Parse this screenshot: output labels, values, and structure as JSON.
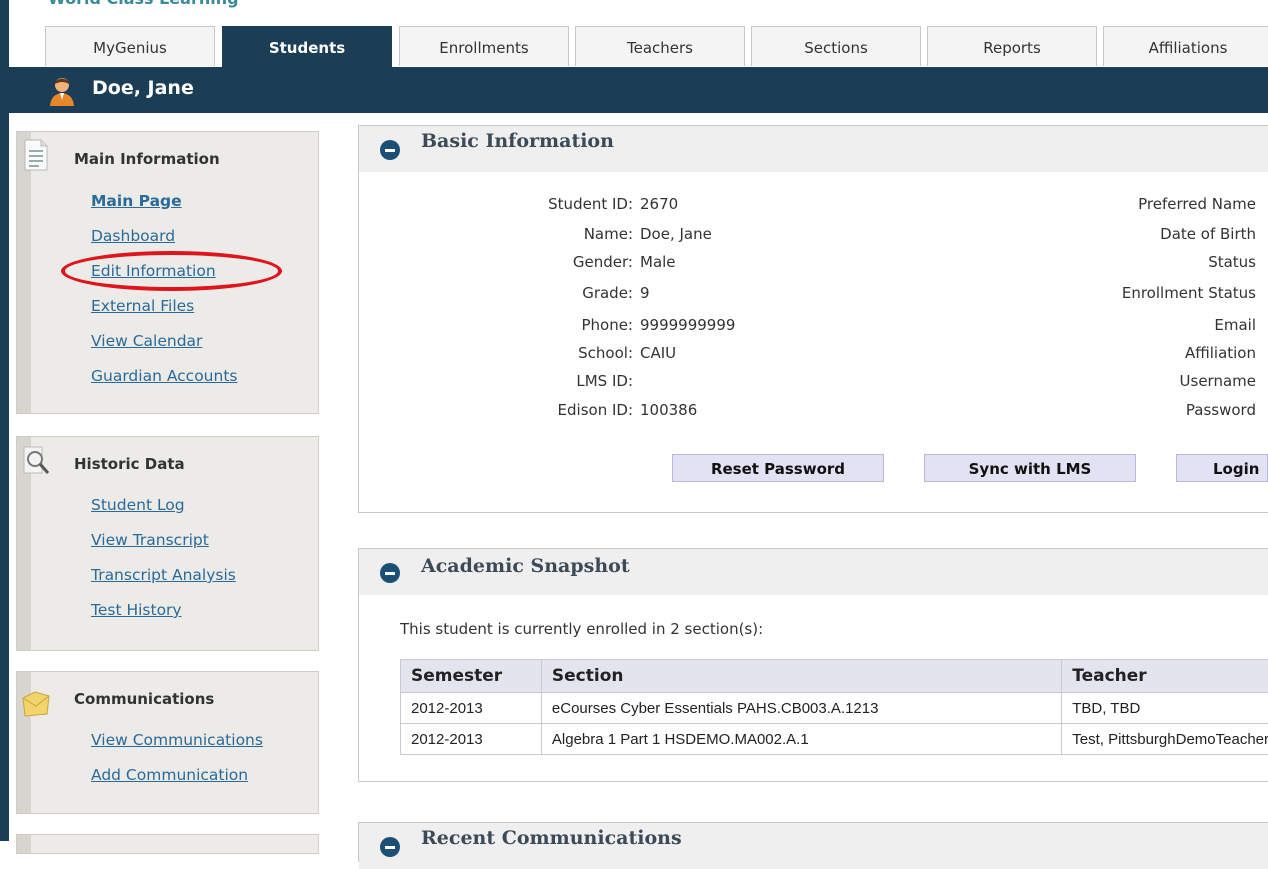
{
  "header": {
    "cut_title": "World Class Learning"
  },
  "tabs": [
    {
      "label": "MyGenius",
      "active": false
    },
    {
      "label": "Students",
      "active": true
    },
    {
      "label": "Enrollments",
      "active": false
    },
    {
      "label": "Teachers",
      "active": false
    },
    {
      "label": "Sections",
      "active": false
    },
    {
      "label": "Reports",
      "active": false
    },
    {
      "label": "Affiliations",
      "active": false
    }
  ],
  "student": {
    "name": "Doe, Jane"
  },
  "sidebar": {
    "main_info": {
      "title": "Main Information",
      "links": [
        "Main Page",
        "Dashboard",
        "Edit Information",
        "External Files",
        "View Calendar",
        "Guardian Accounts"
      ]
    },
    "historic": {
      "title": "Historic Data",
      "links": [
        "Student Log",
        "View Transcript",
        "Transcript Analysis",
        "Test History"
      ]
    },
    "communications": {
      "title": "Communications",
      "links": [
        "View Communications",
        "Add Communication"
      ]
    }
  },
  "basic_info": {
    "title": "Basic Information",
    "fields": [
      {
        "label": "Student ID:",
        "value": "2670"
      },
      {
        "label": "Name:",
        "value": "Doe, Jane"
      },
      {
        "label": "Gender:",
        "value": "Male"
      },
      {
        "label": "Grade:",
        "value": "9"
      },
      {
        "label": "Phone:",
        "value": "9999999999"
      },
      {
        "label": "School:",
        "value": "CAIU"
      },
      {
        "label": "LMS ID:",
        "value": ""
      },
      {
        "label": "Edison ID:",
        "value": "100386"
      }
    ],
    "right_labels": [
      "Preferred Name",
      "Date of Birth",
      "Status",
      "Enrollment Status",
      "Email",
      "Affiliation",
      "Username",
      "Password"
    ],
    "buttons": [
      "Reset Password",
      "Sync with LMS",
      "Login"
    ]
  },
  "academic_snapshot": {
    "title": "Academic Snapshot",
    "summary": "This student is currently enrolled in 2 section(s):",
    "columns": [
      "Semester",
      "Section",
      "Teacher"
    ],
    "rows": [
      [
        "2012-2013",
        "eCourses Cyber Essentials PAHS.CB003.A.1213",
        "TBD, TBD"
      ],
      [
        "2012-2013",
        "Algebra 1 Part 1 HSDEMO.MA002.A.1",
        "Test, PittsburghDemoTeacher"
      ]
    ]
  },
  "recent_comm": {
    "title": "Recent Communications"
  },
  "colors": {
    "navy": "#1b3d55",
    "link": "#2a6a9b",
    "highlight": "#e0141c"
  }
}
